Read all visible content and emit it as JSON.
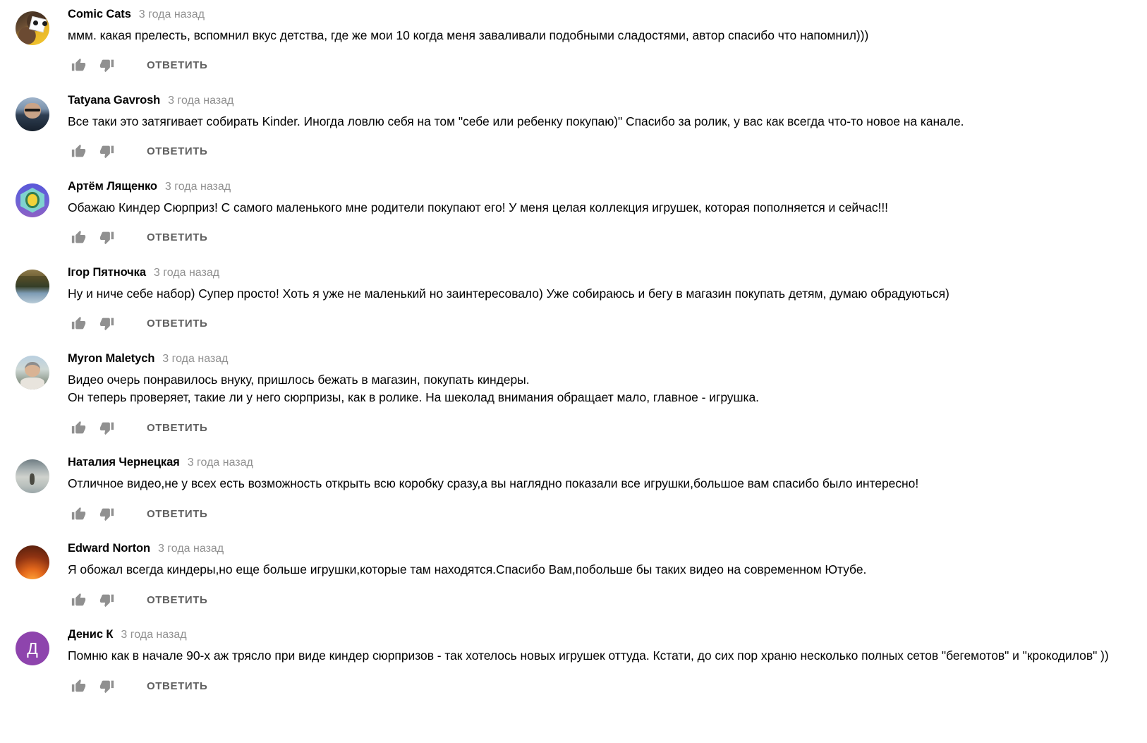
{
  "page": {
    "title": "YouTube comments",
    "reply_label": "ОТВЕТИТЬ",
    "like_icon": "thumbs-up-icon",
    "dislike_icon": "thumbs-down-icon",
    "timestamp_all": "3 года назад",
    "colors": {
      "text": "#030303",
      "muted": "#909090",
      "action_text": "#606060",
      "icon": "#909090",
      "background": "#ffffff"
    }
  },
  "comments": [
    {
      "author": "Comic Cats",
      "timestamp": "3 года назад",
      "text": "ммм. какая прелесть, вспомнил вкус детства, где же мои 10 когда меня заваливали подобными сладостями, автор спасибо что напомнил)))",
      "reply_label": "ОТВЕТИТЬ",
      "avatar_class": "av-comic-cats",
      "avatar_initial": ""
    },
    {
      "author": "Tatyana Gavrosh",
      "timestamp": "3 года назад",
      "text": "Все таки это затягивает собирать Kinder. Иногда ловлю себя на том \"себе или ребенку покупаю)\" Спасибо за ролик, у вас как всегда что-то новое на канале.",
      "reply_label": "ОТВЕТИТЬ",
      "avatar_class": "av-tatyana",
      "avatar_initial": ""
    },
    {
      "author": "Артём Лященко",
      "timestamp": "3 года назад",
      "text": "Обажаю Киндер Сюрприз! С самого маленького мне родители покупают его! У меня целая коллекция игрушек, которая пополняется и сейчас!!!",
      "reply_label": "ОТВЕТИТЬ",
      "avatar_class": "av-artem",
      "avatar_initial": ""
    },
    {
      "author": "Ігор Пятночка",
      "timestamp": "3 года назад",
      "text": "Ну и ниче себе набор) Супер просто! Хоть я уже не маленький но заинтересовало) Уже собираюсь и бегу в магазин покупать детям, думаю обрадуються)",
      "reply_label": "ОТВЕТИТЬ",
      "avatar_class": "av-igor",
      "avatar_initial": ""
    },
    {
      "author": "Myron Maletych",
      "timestamp": "3 года назад",
      "text": "Видео очерь понравилось внуку, пришлось бежать в магазин, покупать киндеры.\nОн теперь проверяет, такие ли у него сюрпризы, как в ролике. На шеколад внимания обращает мало, главное - игрушка.",
      "reply_label": "ОТВЕТИТЬ",
      "avatar_class": "av-myron",
      "avatar_initial": ""
    },
    {
      "author": "Наталия Чернецкая",
      "timestamp": "3 года назад",
      "text": "Отличное видео,не у всех есть возможность открыть всю коробку сразу,а вы наглядно показали все игрушки,большое вам спасибо было интересно!",
      "reply_label": "ОТВЕТИТЬ",
      "avatar_class": "av-natalia",
      "avatar_initial": ""
    },
    {
      "author": "Edward Norton",
      "timestamp": "3 года назад",
      "text": "Я обожал всегда киндеры,но еще больше игрушки,которые там находятся.Спасибо Вам,побольше бы таких видео на современном Ютубе.",
      "reply_label": "ОТВЕТИТЬ",
      "avatar_class": "av-edward",
      "avatar_initial": ""
    },
    {
      "author": "Денис К",
      "timestamp": "3 года назад",
      "text": "Помню как в начале 90-х аж трясло при виде киндер сюрпризов - так хотелось новых игрушек оттуда. Кстати, до сих пор храню несколько полных сетов \"бегемотов\" и \"крокодилов\" ))",
      "reply_label": "ОТВЕТИТЬ",
      "avatar_class": "av-denis",
      "avatar_initial": "Д"
    }
  ]
}
